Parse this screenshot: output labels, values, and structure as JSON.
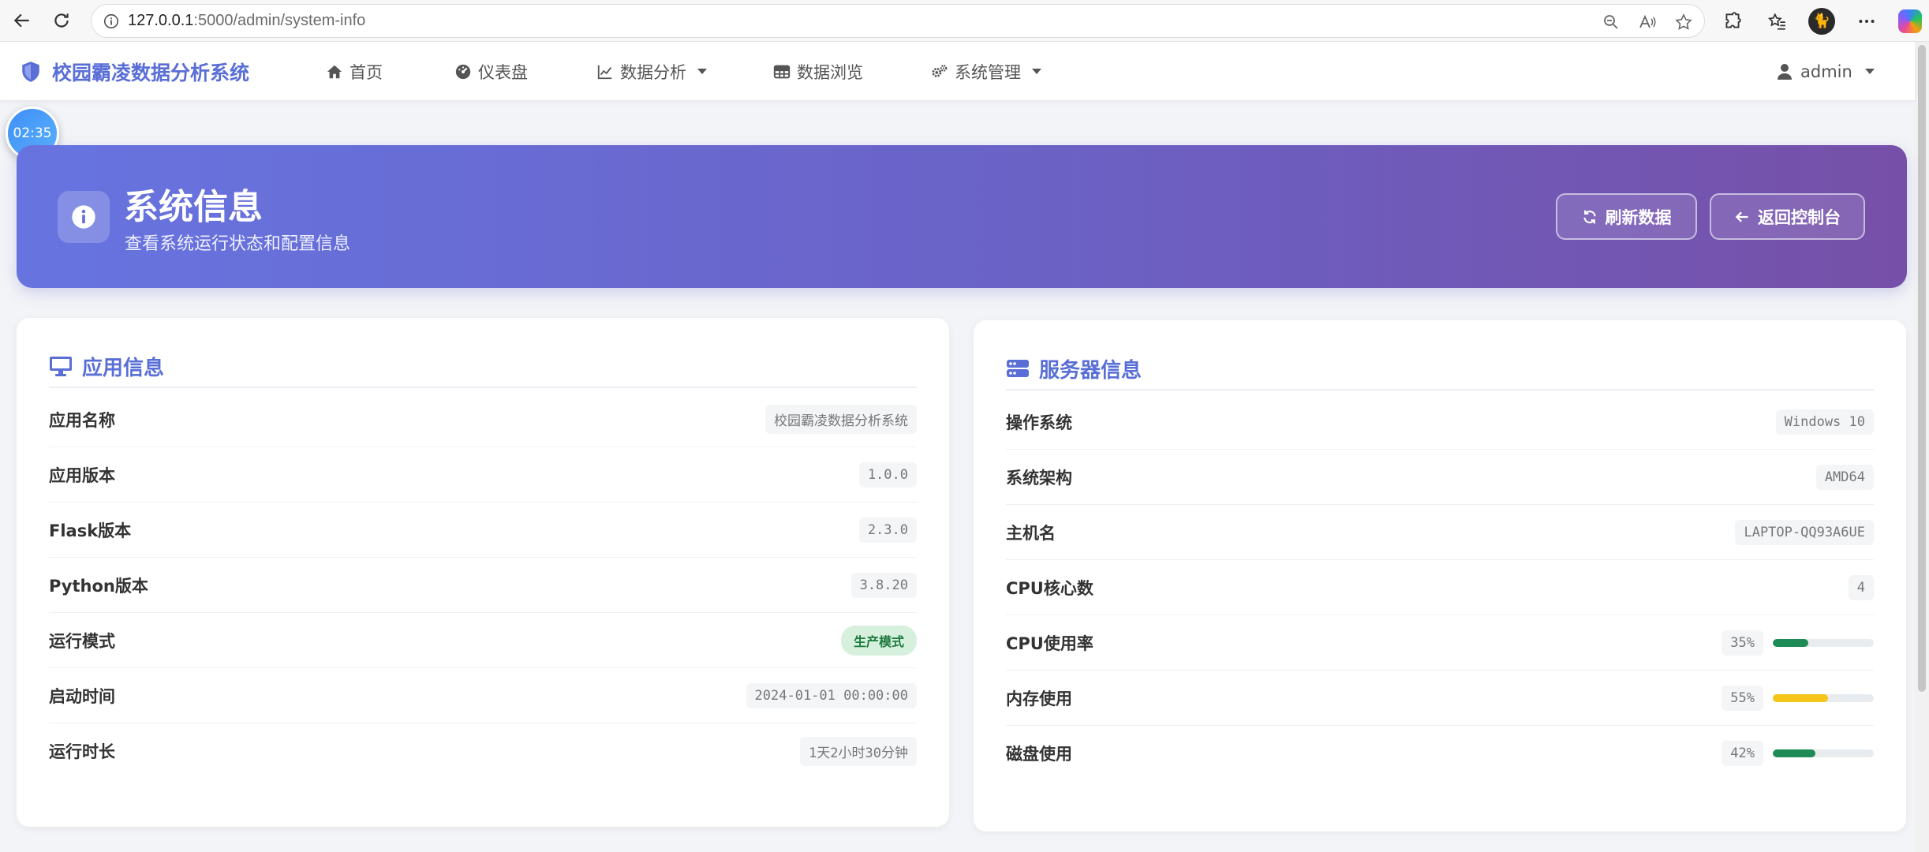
{
  "browser": {
    "url_host": "127.0.0.1",
    "url_rest": ":5000/admin/system-info"
  },
  "navbar": {
    "brand": "校园霸凌数据分析系统",
    "items": [
      {
        "label": "首页"
      },
      {
        "label": "仪表盘"
      },
      {
        "label": "数据分析"
      },
      {
        "label": "数据浏览"
      },
      {
        "label": "系统管理"
      }
    ],
    "user": "admin"
  },
  "timer": "02:35",
  "header": {
    "title": "系统信息",
    "subtitle": "查看系统运行状态和配置信息",
    "refresh_label": "刷新数据",
    "back_label": "返回控制台"
  },
  "app_info": {
    "title": "应用信息",
    "rows": [
      {
        "label": "应用名称",
        "value": "校园霸凌数据分析系统"
      },
      {
        "label": "应用版本",
        "value": "1.0.0"
      },
      {
        "label": "Flask版本",
        "value": "2.3.0"
      },
      {
        "label": "Python版本",
        "value": "3.8.20"
      },
      {
        "label": "运行模式",
        "value": "生产模式"
      },
      {
        "label": "启动时间",
        "value": "2024-01-01 00:00:00"
      },
      {
        "label": "运行时长",
        "value": "1天2小时30分钟"
      }
    ]
  },
  "server_info": {
    "title": "服务器信息",
    "rows": [
      {
        "label": "操作系统",
        "value": "Windows 10"
      },
      {
        "label": "系统架构",
        "value": "AMD64"
      },
      {
        "label": "主机名",
        "value": "LAPTOP-QQ93A6UE"
      },
      {
        "label": "CPU核心数",
        "value": "4"
      },
      {
        "label": "CPU使用率",
        "value": "35%",
        "percent": 35,
        "color": "#1e8a55"
      },
      {
        "label": "内存使用",
        "value": "55%",
        "percent": 55,
        "color": "#f5c518"
      },
      {
        "label": "磁盘使用",
        "value": "42%",
        "percent": 42,
        "color": "#1e8a55"
      }
    ]
  },
  "colors": {
    "accent": "#5a6fd6",
    "badge_bg": "#d6f0dd",
    "badge_fg": "#1f7a3f"
  }
}
